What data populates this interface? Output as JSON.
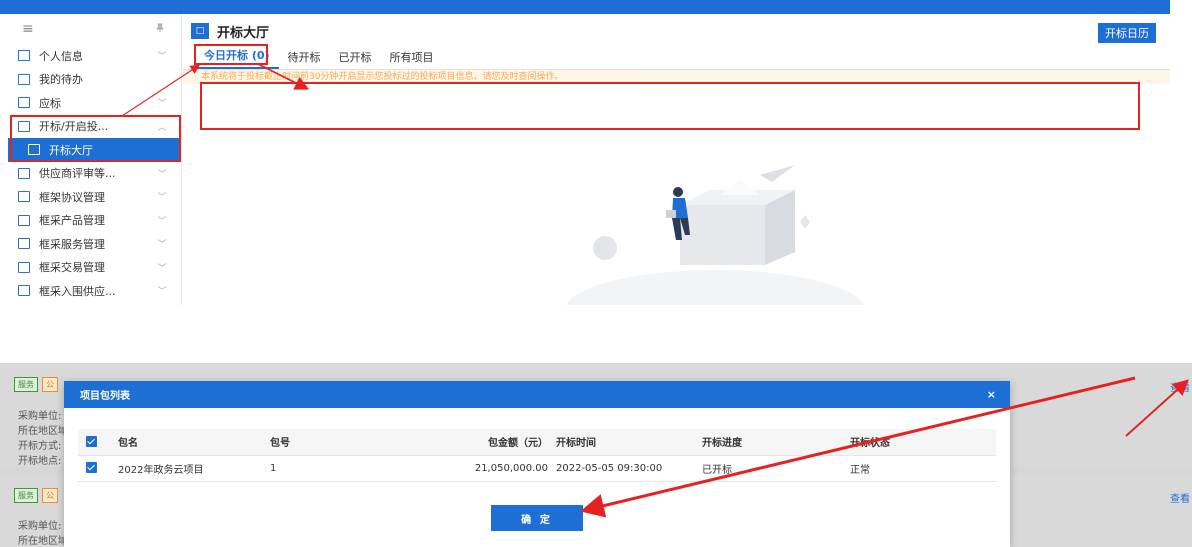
{
  "top": {
    "sidebar": {
      "menu_icon": "≡",
      "pin_icon": "📌",
      "items": [
        {
          "label": "个人信息",
          "chev": "﹀"
        },
        {
          "label": "我的待办",
          "chev": ""
        },
        {
          "label": "应标",
          "chev": "﹀"
        },
        {
          "label": "开标/开启投...",
          "chev": "︿"
        },
        {
          "label": "开标大厅",
          "chev": ""
        },
        {
          "label": "供应商评审等...",
          "chev": "﹀"
        },
        {
          "label": "框架协议管理",
          "chev": "﹀"
        },
        {
          "label": "框采产品管理",
          "chev": "﹀"
        },
        {
          "label": "框采服务管理",
          "chev": "﹀"
        },
        {
          "label": "框采交易管理",
          "chev": "﹀"
        },
        {
          "label": "框采入围供应...",
          "chev": "﹀"
        }
      ]
    },
    "header": {
      "tag": "□",
      "title": "开标大厅",
      "calendar_button": "开标日历"
    },
    "tabs": [
      {
        "label": "今日开标 (0)"
      },
      {
        "label": "待开标"
      },
      {
        "label": "已开标"
      },
      {
        "label": "所有项目"
      }
    ],
    "notice": "本系统将于投标截止时间前30分钟开启显示您投标过的投标项目信息，请您及时查阅操作。"
  },
  "bottom": {
    "bg": {
      "badge_service": "服务",
      "badge_other": "公",
      "labels": [
        "采购单位:",
        "所在地区域",
        "开标方式:",
        "开标地点:"
      ],
      "labels2": [
        "采购单位:",
        "所在地区域"
      ],
      "link_view": "查看"
    },
    "modal": {
      "title": "项目包列表",
      "close": "×",
      "columns": [
        "包名",
        "包号",
        "包金额（元）",
        "开标时间",
        "开标进度",
        "开标状态"
      ],
      "rows": [
        [
          "2022年政务云项目",
          "1",
          "21,050,000.00",
          "2022-05-05 09:30:00",
          "已开标",
          "正常"
        ]
      ],
      "confirm_button": "确 定"
    }
  },
  "colors": {
    "primary": "#1e6fd4",
    "highlight": "#e52222",
    "notice_bg": "#fff5e6",
    "notice_text": "#f0a030"
  }
}
